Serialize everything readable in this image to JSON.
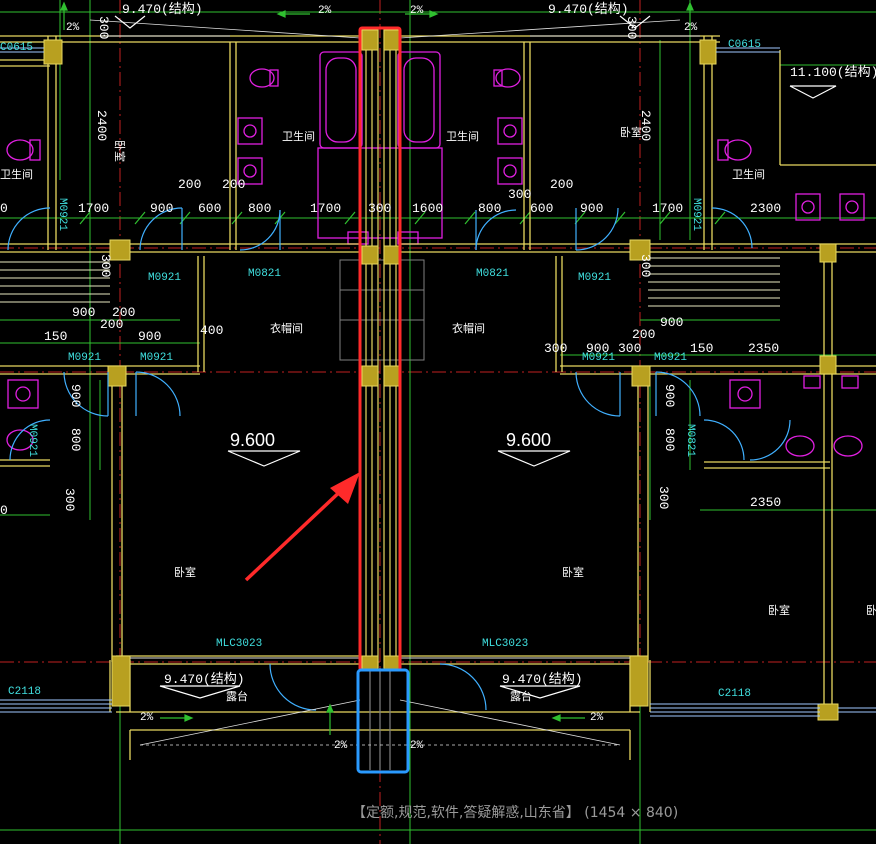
{
  "elevations": {
    "top_left": "9.470(结构)",
    "top_right": "9.470(结构)",
    "right_upper": "11.100(结构)",
    "floor_left": "9.600",
    "floor_right": "9.600",
    "balcony_left": "9.470(结构)",
    "balcony_right": "9.470(结构)"
  },
  "slopes": {
    "s": "2%"
  },
  "rooms": {
    "bedroom": "卧室",
    "bathroom": "卫生间",
    "closet": "衣帽间",
    "balcony": "露台"
  },
  "doors": {
    "m0921": "M0921",
    "m0821": "M0821",
    "mlc3023": "MLC3023",
    "c2118": "C2118",
    "c0615": "C0615"
  },
  "dims": {
    "d2400": "2400",
    "d200": "200",
    "d300": "300",
    "d1700": "1700",
    "d900": "900",
    "d600": "600",
    "d800": "800",
    "d1600": "1600",
    "d400": "400",
    "d150": "150",
    "d2300": "2300",
    "d2350": "2350",
    "d0": "0"
  },
  "caption": {
    "text": "【定额,规范,软件,答疑解惑,山东省】 (1454 × 840)"
  },
  "colors": {
    "wall": "#e8d860",
    "column": "#b8a020",
    "axis": "#c02020",
    "dim_line": "#30c030",
    "door_arc": "#40b0ff",
    "fixture": "#e020e0",
    "highlight_red": "#ff2a2a",
    "highlight_blue": "#2a9aff"
  }
}
